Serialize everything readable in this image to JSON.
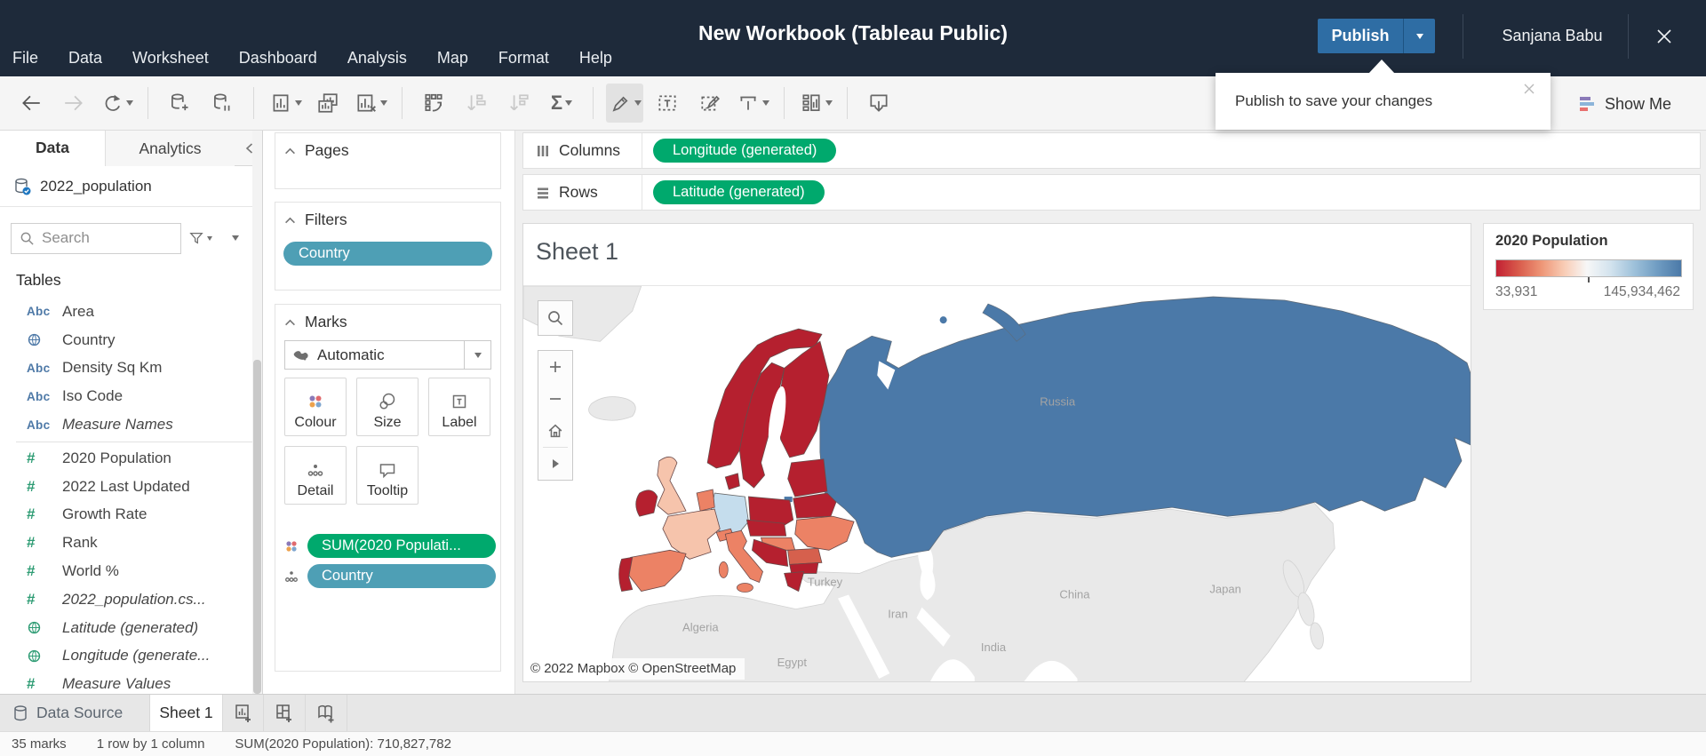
{
  "app": {
    "title": "New Workbook (Tableau Public)",
    "publish_label": "Publish",
    "user": "Sanjana Babu"
  },
  "menu": {
    "items": [
      "File",
      "Data",
      "Worksheet",
      "Dashboard",
      "Analysis",
      "Map",
      "Format",
      "Help"
    ]
  },
  "publish_tooltip": {
    "text": "Publish to save your changes"
  },
  "toolbar": {
    "show_me": "Show Me",
    "sigma_glyph": "Σ"
  },
  "icons": {
    "abc": "Abc",
    "hash": "#"
  },
  "data_panel": {
    "tabs": {
      "data": "Data",
      "analytics": "Analytics"
    },
    "datasource": "2022_population",
    "search_placeholder": "Search",
    "tables_heading": "Tables",
    "fields": [
      {
        "icon": "abc",
        "label": "Area"
      },
      {
        "icon": "globe-blue",
        "label": "Country"
      },
      {
        "icon": "abc",
        "label": "Density Sq Km"
      },
      {
        "icon": "abc",
        "label": "Iso Code"
      },
      {
        "icon": "abc",
        "label": "Measure Names"
      },
      {
        "icon": "hash",
        "label": "2020 Population"
      },
      {
        "icon": "hash",
        "label": "2022 Last Updated"
      },
      {
        "icon": "hash",
        "label": "Growth Rate"
      },
      {
        "icon": "hash",
        "label": "Rank"
      },
      {
        "icon": "hash",
        "label": "World %"
      },
      {
        "icon": "hash",
        "label": "2022_population.cs..."
      },
      {
        "icon": "globe-green",
        "label": "Latitude (generated)"
      },
      {
        "icon": "globe-green",
        "label": "Longitude (generate..."
      },
      {
        "icon": "hash",
        "label": "Measure Values"
      }
    ]
  },
  "cards": {
    "pages": {
      "header": "Pages"
    },
    "filters": {
      "header": "Filters",
      "pill": "Country"
    },
    "marks": {
      "header": "Marks",
      "type": "Automatic",
      "buttons": [
        "Colour",
        "Size",
        "Label",
        "Detail",
        "Tooltip"
      ],
      "pills": [
        {
          "label": "SUM(2020 Populati...",
          "color": "green"
        },
        {
          "label": "Country",
          "color": "teal"
        }
      ]
    }
  },
  "shelves": {
    "columns": {
      "label": "Columns",
      "pill": "Longitude (generated)"
    },
    "rows": {
      "label": "Rows",
      "pill": "Latitude (generated)"
    }
  },
  "sheet": {
    "title": "Sheet 1",
    "attribution": "© 2022 Mapbox © OpenStreetMap",
    "map_labels": {
      "russia": "Russia",
      "turkey": "Turkey",
      "iran": "Iran",
      "china": "China",
      "japan": "Japan",
      "algeria": "Algeria",
      "egypt": "Egypt",
      "india": "India"
    },
    "colors": {
      "dark_red": "#b5202f",
      "mid_red": "#d6604d",
      "salmon": "#ec8265",
      "light_pink": "#f6c4ac",
      "light_blue": "#c5dded",
      "russia_blue": "#4b79a8",
      "no_data_gray": "#e9e9e9"
    }
  },
  "legend": {
    "title": "2020 Population",
    "min": "33,931",
    "max": "145,934,462"
  },
  "bottom_tabs": {
    "data_source": "Data Source",
    "sheet": "Sheet 1"
  },
  "status_bar": {
    "marks": "35 marks",
    "size": "1 row by 1 column",
    "aggregate": "SUM(2020 Population): 710,827,782"
  }
}
